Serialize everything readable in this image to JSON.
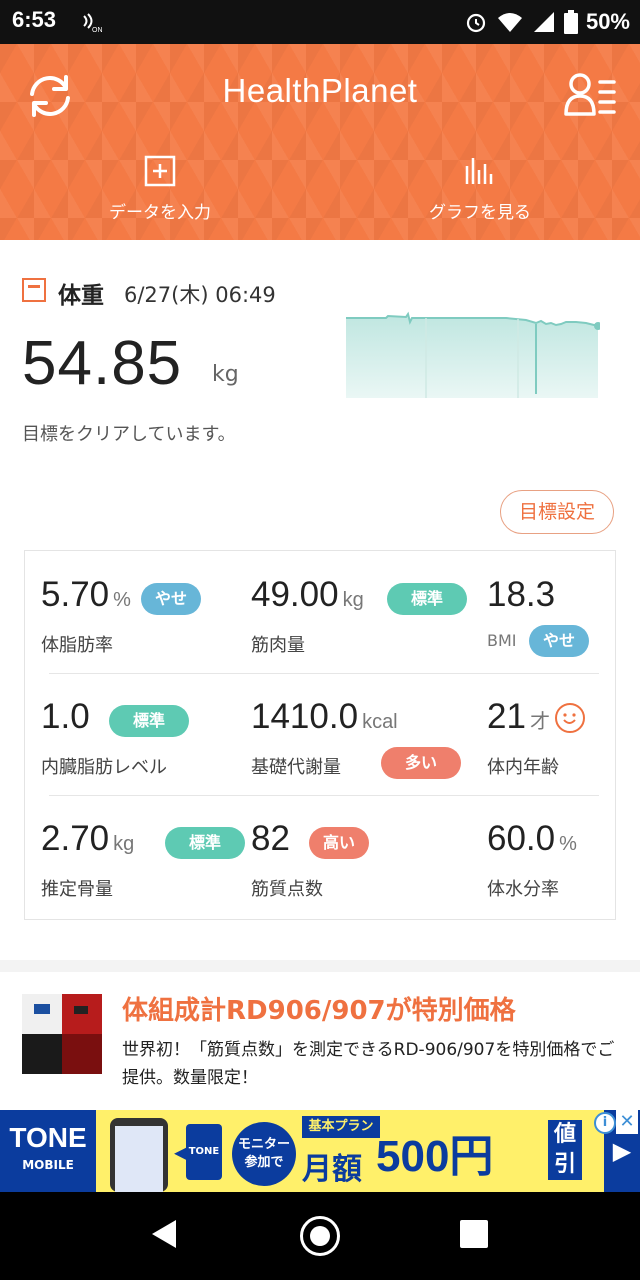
{
  "status": {
    "time": "6:53",
    "nfc_label": "ON",
    "battery": "50%"
  },
  "header": {
    "title": "HealthPlanet",
    "action_input": "データを入力",
    "action_graph": "グラフを見る"
  },
  "weight": {
    "label": "体重",
    "datetime": "6/27(木) 06:49",
    "value": "54.85",
    "unit": "kg",
    "message": "目標をクリアしています。",
    "goal_button": "目標設定"
  },
  "stats": [
    {
      "value": "5.70",
      "unit": "%",
      "name": "体脂肪率",
      "badge": "やせ",
      "badge_color": "#67b6d8"
    },
    {
      "value": "49.00",
      "unit": "kg",
      "name": "筋肉量",
      "badge": "標準",
      "badge_color": "#5ecab3"
    },
    {
      "value": "18.3",
      "unit": "",
      "name": "BMI",
      "badge": "やせ",
      "badge_color": "#67b6d8"
    },
    {
      "value": "1.0",
      "unit": "",
      "name": "内臓脂肪レベル",
      "badge": "標準",
      "badge_color": "#5ecab3"
    },
    {
      "value": "1410.0",
      "unit": "kcal",
      "name": "基礎代謝量",
      "badge": "多い",
      "badge_color": "#ef7f6c"
    },
    {
      "value": "21",
      "unit": "才",
      "name": "体内年齢",
      "badge": "",
      "badge_color": ""
    },
    {
      "value": "2.70",
      "unit": "kg",
      "name": "推定骨量",
      "badge": "標準",
      "badge_color": "#5ecab3"
    },
    {
      "value": "82",
      "unit": "",
      "name": "筋質点数",
      "badge": "高い",
      "badge_color": "#ef7f6c"
    },
    {
      "value": "60.0",
      "unit": "%",
      "name": "体水分率",
      "badge": "",
      "badge_color": ""
    }
  ],
  "ad": {
    "headline": "体組成計RD906/907が特別価格",
    "body": "世界初！「筋質点数」を測定できるRD-906/907を特別価格でご提供。数量限定！"
  },
  "banner": {
    "brand": "TONE",
    "brand_sub": "MOBILE",
    "tone_box": "TONE",
    "monitor": "モニター参加で",
    "plan": "基本プラン",
    "monthly": "月額",
    "price": "500円",
    "discount": "値引"
  },
  "icons": {
    "refresh": "refresh-icon",
    "profile": "profile-menu-icon",
    "add": "add-data-icon",
    "graph": "graph-icon",
    "face": "smile-face-icon"
  }
}
